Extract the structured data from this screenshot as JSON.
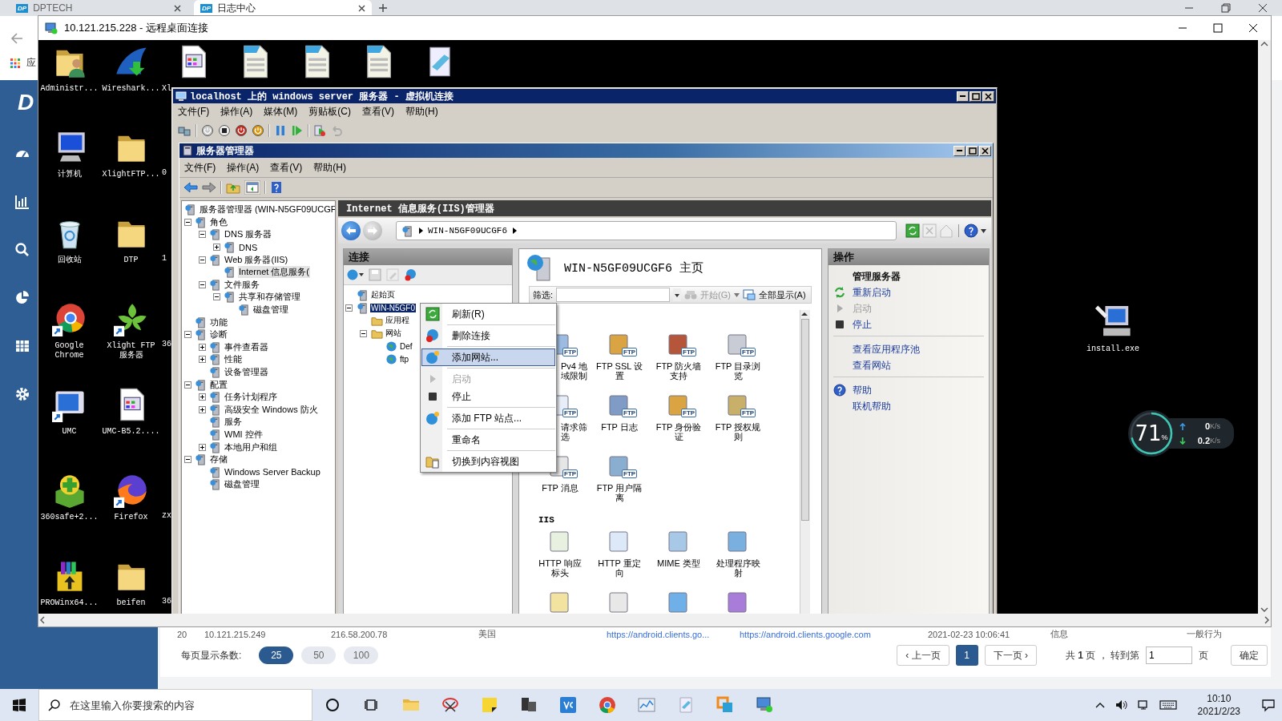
{
  "browser": {
    "tabs": [
      {
        "label": "DPTECH",
        "favicon_text": "DP",
        "selected": false
      },
      {
        "label": "日志中心",
        "favicon_text": "DP",
        "selected": true
      }
    ],
    "bookmark_fragment": "应",
    "sidebar_logo_fragment": "D",
    "table_row": [
      {
        "text": "20",
        "kind": "text"
      },
      {
        "text": "10.121.215.249",
        "kind": "text"
      },
      {
        "text": "216.58.200.78",
        "kind": "text"
      },
      {
        "text": "美国",
        "kind": "text"
      },
      {
        "text": "https://android.clients.go...",
        "kind": "link"
      },
      {
        "text": "https://android.clients.google.com",
        "kind": "link"
      },
      {
        "text": "2021-02-23 10:06:41",
        "kind": "text"
      },
      {
        "text": "信息",
        "kind": "text"
      },
      {
        "text": "一般行为",
        "kind": "text"
      }
    ],
    "pagination": {
      "page_size_label": "每页显示条数:",
      "page_sizes": [
        {
          "label": "25",
          "selected": true
        },
        {
          "label": "50",
          "selected": false
        },
        {
          "label": "100",
          "selected": false
        }
      ],
      "prev": "‹ 上一页",
      "pages": [
        {
          "label": "1",
          "selected": true
        }
      ],
      "next": "下一页 ›",
      "summary": "共 **1** 页 ， 转到第",
      "goto_value": "1",
      "page_unit": "页",
      "confirm": "确定"
    }
  },
  "remote_desktop": {
    "title": "10.121.215.228 - 远程桌面连接",
    "desktop_icons": [
      {
        "label": "Administr..."
      },
      {
        "label": "计算机"
      },
      {
        "label": "回收站"
      },
      {
        "label": "Google Chrome"
      },
      {
        "label": "UMC"
      },
      {
        "label": "360safe+2..."
      },
      {
        "label": "PROWinx64..."
      },
      {
        "label": "Wireshark..."
      },
      {
        "label": "XlightFTP..."
      },
      {
        "label": "DTP"
      },
      {
        "label": "Xlight FTP 服务器"
      },
      {
        "label": "UMC-B5.2...."
      },
      {
        "label": "Firefox"
      },
      {
        "label": "beifen"
      }
    ],
    "partly_hidden_labels": [
      "Xl",
      "0",
      "1",
      "36",
      "zx",
      "36"
    ],
    "install_icon": {
      "label": "install.exe"
    },
    "speed_widget": {
      "percent": "71",
      "percent_sign": "%",
      "upload": "0",
      "upload_unit": "K/s",
      "download": "0.2",
      "download_unit": "K/s"
    }
  },
  "vm_window": {
    "title": "localhost 上的 windows server 服务器 - 虚拟机连接",
    "menu": [
      "文件(F)",
      "操作(A)",
      "媒体(M)",
      "剪贴板(C)",
      "查看(V)",
      "帮助(H)"
    ]
  },
  "server_manager": {
    "title": "服务器管理器",
    "menu": [
      "文件(F)",
      "操作(A)",
      "查看(V)",
      "帮助(H)"
    ],
    "tree": [
      {
        "label": "服务器管理器 (WIN-N5GF09UCGF",
        "selected": false,
        "children": [
          {
            "label": "角色",
            "expanded": true,
            "selected": false,
            "children": [
              {
                "label": "DNS 服务器",
                "expanded": true,
                "selected": false,
                "children": [
                  {
                    "label": "DNS",
                    "expanded": false,
                    "selected": false
                  }
                ]
              },
              {
                "label": "Web 服务器(IIS)",
                "expanded": true,
                "selected": false,
                "children": [
                  {
                    "label": "Internet 信息服务(",
                    "selected": true
                  }
                ]
              },
              {
                "label": "文件服务",
                "expanded": true,
                "selected": false,
                "children": [
                  {
                    "label": "共享和存储管理",
                    "expanded": true,
                    "selected": false,
                    "children": [
                      {
                        "label": "磁盘管理",
                        "selected": false
                      }
                    ]
                  }
                ]
              }
            ]
          },
          {
            "label": "功能",
            "selected": false
          },
          {
            "label": "诊断",
            "expanded": true,
            "selected": false,
            "children": [
              {
                "label": "事件查看器",
                "expanded": false,
                "selected": false
              },
              {
                "label": "性能",
                "expanded": false,
                "selected": false
              },
              {
                "label": "设备管理器",
                "selected": false
              }
            ]
          },
          {
            "label": "配置",
            "expanded": true,
            "selected": false,
            "children": [
              {
                "label": "任务计划程序",
                "expanded": false,
                "selected": false
              },
              {
                "label": "高级安全 Windows 防火",
                "expanded": false,
                "selected": false
              },
              {
                "label": "服务",
                "selected": false
              },
              {
                "label": "WMI 控件",
                "selected": false
              },
              {
                "label": "本地用户和组",
                "expanded": false,
                "selected": false
              }
            ]
          },
          {
            "label": "存储",
            "expanded": true,
            "selected": false,
            "children": [
              {
                "label": "Windows Server Backup",
                "selected": false
              },
              {
                "label": "磁盘管理",
                "selected": false
              }
            ]
          }
        ]
      }
    ]
  },
  "iis": {
    "title": "Internet 信息服务(IIS)管理器",
    "breadcrumb": "WIN-N5GF09UCGF6",
    "connections": {
      "title": "连接",
      "tree": [
        {
          "label": "起始页",
          "selected": false
        },
        {
          "label": "WIN-N5GF0",
          "expanded": true,
          "selected": true,
          "children": [
            {
              "label": "应用程",
              "selected": false
            },
            {
              "label": "网站",
              "expanded": true,
              "selected": false,
              "children": [
                {
                  "label": "Def",
                  "selected": false
                },
                {
                  "label": "ftp",
                  "selected": false
                }
              ]
            }
          ]
        }
      ]
    },
    "home": {
      "title": "WIN-N5GF09UCGF6 主页",
      "filter_label": "筛选:",
      "go": "开始(G)",
      "show_all": "全部显示(A)",
      "features": [
        {
          "label": "Pv4 地域限制",
          "badge": "FTP"
        },
        {
          "label": "FTP SSL 设置",
          "badge": "FTP"
        },
        {
          "label": "FTP 防火墙支持",
          "badge": "FTP"
        },
        {
          "label": "FTP 目录浏览",
          "badge": "FTP"
        },
        {
          "label": "请求筛选",
          "badge": "FTP"
        },
        {
          "label": "FTP 日志",
          "badge": "FTP"
        },
        {
          "label": "FTP 身份验证",
          "badge": "FTP"
        },
        {
          "label": "FTP 授权规则",
          "badge": "FTP"
        },
        {
          "label": "FTP 消息",
          "badge": "FTP"
        },
        {
          "label": "FTP 用户隔离",
          "badge": "FTP"
        }
      ],
      "section_title": "IIS",
      "section_features": [
        {
          "label": "HTTP 响应标头"
        },
        {
          "label": "HTTP 重定向"
        },
        {
          "label": "MIME 类型"
        },
        {
          "label": "处理程序映射"
        }
      ]
    },
    "actions": {
      "title": "操作",
      "groups": [
        {
          "items": [
            {
              "label": "管理服务器",
              "kind": "heading"
            },
            {
              "label": "重新启动",
              "kind": "link",
              "disabled": false
            },
            {
              "label": "启动",
              "kind": "link",
              "disabled": true
            },
            {
              "label": "停止",
              "kind": "link",
              "disabled": false
            }
          ]
        },
        {
          "items": [
            {
              "label": "查看应用程序池",
              "kind": "link",
              "disabled": false
            },
            {
              "label": "查看网站",
              "kind": "link",
              "disabled": false
            }
          ]
        },
        {
          "items": [
            {
              "label": "帮助",
              "kind": "link",
              "disabled": false
            },
            {
              "label": "联机帮助",
              "kind": "link",
              "disabled": false
            }
          ]
        }
      ]
    }
  },
  "context_menu": {
    "groups": [
      [
        {
          "label": "刷新(R)",
          "selected": false,
          "disabled": false
        }
      ],
      [
        {
          "label": "删除连接",
          "selected": false,
          "disabled": false
        }
      ],
      [
        {
          "label": "添加网站...",
          "selected": true,
          "disabled": false
        }
      ],
      [
        {
          "label": "启动",
          "selected": false,
          "disabled": true
        },
        {
          "label": "停止",
          "selected": false,
          "disabled": false
        }
      ],
      [
        {
          "label": "添加 FTP 站点...",
          "selected": false,
          "disabled": false
        }
      ],
      [
        {
          "label": "重命名",
          "selected": false,
          "disabled": false
        }
      ],
      [
        {
          "label": "切换到内容视图",
          "selected": false,
          "disabled": false
        }
      ]
    ]
  },
  "taskbar": {
    "search_placeholder": "在这里输入你要搜索的内容",
    "time": "10:10",
    "date": "2021/2/23"
  }
}
